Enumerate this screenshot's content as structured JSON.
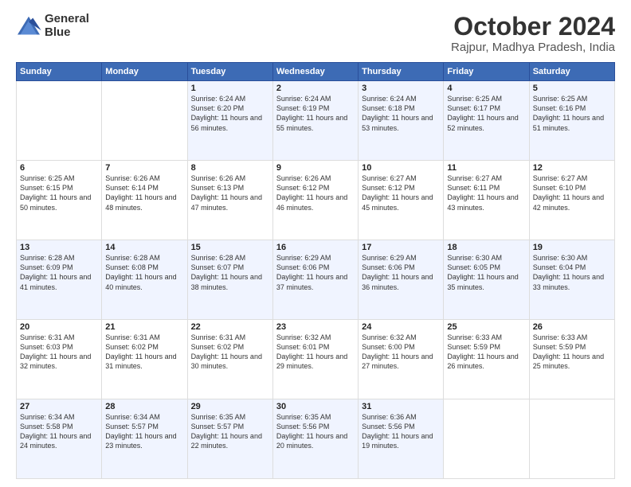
{
  "header": {
    "logo_line1": "General",
    "logo_line2": "Blue",
    "title": "October 2024",
    "subtitle": "Rajpur, Madhya Pradesh, India"
  },
  "calendar": {
    "days_of_week": [
      "Sunday",
      "Monday",
      "Tuesday",
      "Wednesday",
      "Thursday",
      "Friday",
      "Saturday"
    ],
    "weeks": [
      [
        {
          "day": "",
          "info": ""
        },
        {
          "day": "",
          "info": ""
        },
        {
          "day": "1",
          "info": "Sunrise: 6:24 AM\nSunset: 6:20 PM\nDaylight: 11 hours and 56 minutes."
        },
        {
          "day": "2",
          "info": "Sunrise: 6:24 AM\nSunset: 6:19 PM\nDaylight: 11 hours and 55 minutes."
        },
        {
          "day": "3",
          "info": "Sunrise: 6:24 AM\nSunset: 6:18 PM\nDaylight: 11 hours and 53 minutes."
        },
        {
          "day": "4",
          "info": "Sunrise: 6:25 AM\nSunset: 6:17 PM\nDaylight: 11 hours and 52 minutes."
        },
        {
          "day": "5",
          "info": "Sunrise: 6:25 AM\nSunset: 6:16 PM\nDaylight: 11 hours and 51 minutes."
        }
      ],
      [
        {
          "day": "6",
          "info": "Sunrise: 6:25 AM\nSunset: 6:15 PM\nDaylight: 11 hours and 50 minutes."
        },
        {
          "day": "7",
          "info": "Sunrise: 6:26 AM\nSunset: 6:14 PM\nDaylight: 11 hours and 48 minutes."
        },
        {
          "day": "8",
          "info": "Sunrise: 6:26 AM\nSunset: 6:13 PM\nDaylight: 11 hours and 47 minutes."
        },
        {
          "day": "9",
          "info": "Sunrise: 6:26 AM\nSunset: 6:12 PM\nDaylight: 11 hours and 46 minutes."
        },
        {
          "day": "10",
          "info": "Sunrise: 6:27 AM\nSunset: 6:12 PM\nDaylight: 11 hours and 45 minutes."
        },
        {
          "day": "11",
          "info": "Sunrise: 6:27 AM\nSunset: 6:11 PM\nDaylight: 11 hours and 43 minutes."
        },
        {
          "day": "12",
          "info": "Sunrise: 6:27 AM\nSunset: 6:10 PM\nDaylight: 11 hours and 42 minutes."
        }
      ],
      [
        {
          "day": "13",
          "info": "Sunrise: 6:28 AM\nSunset: 6:09 PM\nDaylight: 11 hours and 41 minutes."
        },
        {
          "day": "14",
          "info": "Sunrise: 6:28 AM\nSunset: 6:08 PM\nDaylight: 11 hours and 40 minutes."
        },
        {
          "day": "15",
          "info": "Sunrise: 6:28 AM\nSunset: 6:07 PM\nDaylight: 11 hours and 38 minutes."
        },
        {
          "day": "16",
          "info": "Sunrise: 6:29 AM\nSunset: 6:06 PM\nDaylight: 11 hours and 37 minutes."
        },
        {
          "day": "17",
          "info": "Sunrise: 6:29 AM\nSunset: 6:06 PM\nDaylight: 11 hours and 36 minutes."
        },
        {
          "day": "18",
          "info": "Sunrise: 6:30 AM\nSunset: 6:05 PM\nDaylight: 11 hours and 35 minutes."
        },
        {
          "day": "19",
          "info": "Sunrise: 6:30 AM\nSunset: 6:04 PM\nDaylight: 11 hours and 33 minutes."
        }
      ],
      [
        {
          "day": "20",
          "info": "Sunrise: 6:31 AM\nSunset: 6:03 PM\nDaylight: 11 hours and 32 minutes."
        },
        {
          "day": "21",
          "info": "Sunrise: 6:31 AM\nSunset: 6:02 PM\nDaylight: 11 hours and 31 minutes."
        },
        {
          "day": "22",
          "info": "Sunrise: 6:31 AM\nSunset: 6:02 PM\nDaylight: 11 hours and 30 minutes."
        },
        {
          "day": "23",
          "info": "Sunrise: 6:32 AM\nSunset: 6:01 PM\nDaylight: 11 hours and 29 minutes."
        },
        {
          "day": "24",
          "info": "Sunrise: 6:32 AM\nSunset: 6:00 PM\nDaylight: 11 hours and 27 minutes."
        },
        {
          "day": "25",
          "info": "Sunrise: 6:33 AM\nSunset: 5:59 PM\nDaylight: 11 hours and 26 minutes."
        },
        {
          "day": "26",
          "info": "Sunrise: 6:33 AM\nSunset: 5:59 PM\nDaylight: 11 hours and 25 minutes."
        }
      ],
      [
        {
          "day": "27",
          "info": "Sunrise: 6:34 AM\nSunset: 5:58 PM\nDaylight: 11 hours and 24 minutes."
        },
        {
          "day": "28",
          "info": "Sunrise: 6:34 AM\nSunset: 5:57 PM\nDaylight: 11 hours and 23 minutes."
        },
        {
          "day": "29",
          "info": "Sunrise: 6:35 AM\nSunset: 5:57 PM\nDaylight: 11 hours and 22 minutes."
        },
        {
          "day": "30",
          "info": "Sunrise: 6:35 AM\nSunset: 5:56 PM\nDaylight: 11 hours and 20 minutes."
        },
        {
          "day": "31",
          "info": "Sunrise: 6:36 AM\nSunset: 5:56 PM\nDaylight: 11 hours and 19 minutes."
        },
        {
          "day": "",
          "info": ""
        },
        {
          "day": "",
          "info": ""
        }
      ]
    ]
  }
}
